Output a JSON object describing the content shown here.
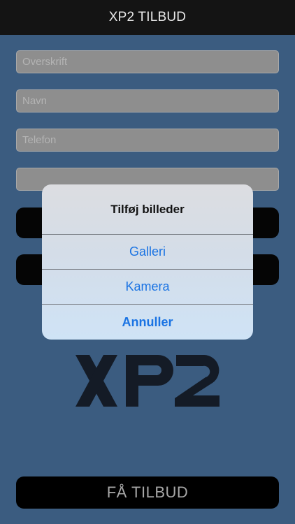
{
  "nav": {
    "title": "XP2 TILBUD"
  },
  "form": {
    "headline_placeholder": "Overskrift",
    "name_placeholder": "Navn",
    "phone_placeholder": "Telefon",
    "extra_placeholder": ""
  },
  "logo": {
    "text": "XP2"
  },
  "cta": {
    "label": "FÅ TILBUD"
  },
  "action_sheet": {
    "title": "Tilføj billeder",
    "gallery": "Galleri",
    "camera": "Kamera",
    "cancel": "Annuller"
  },
  "colors": {
    "background": "#3b5c80",
    "nav_bar": "#141414",
    "action_blue": "#1a73e3"
  }
}
